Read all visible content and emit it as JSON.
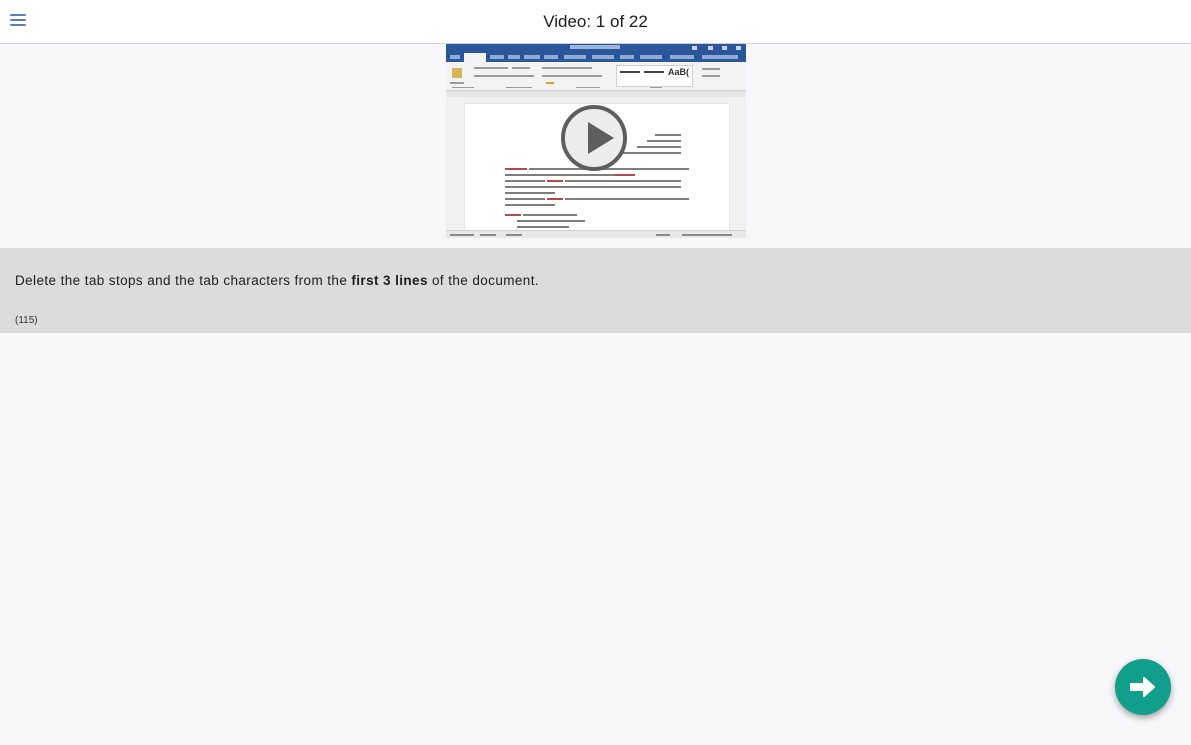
{
  "header": {
    "menu_icon": "hamburger-menu-icon",
    "title": "Video: 1 of 22"
  },
  "video": {
    "play_icon": "play-icon"
  },
  "task": {
    "instruction_before": "Delete the tab stops and the tab characters from the ",
    "instruction_bold": "first 3 lines",
    "instruction_after": " of the document.",
    "code": "(115)"
  },
  "navigation": {
    "next_icon": "arrow-right-icon"
  },
  "colors": {
    "accent": "#119e8a",
    "word_blue": "#2b579a",
    "info_panel": "#dcdcdf"
  }
}
